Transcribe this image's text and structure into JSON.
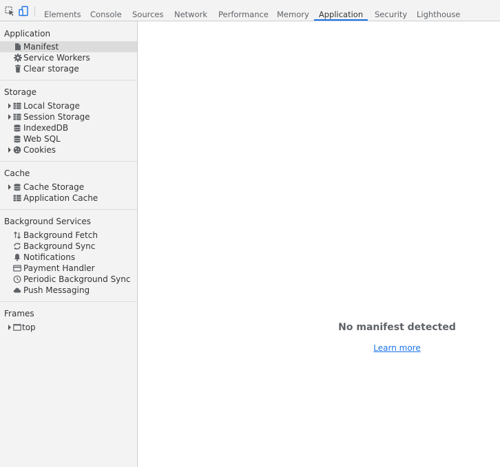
{
  "tabs": [
    "Elements",
    "Console",
    "Sources",
    "Network",
    "Performance",
    "Memory",
    "Application",
    "Security",
    "Lighthouse"
  ],
  "active_tab": "Application",
  "sidebar": {
    "application": {
      "title": "Application",
      "items": [
        {
          "label": "Manifest",
          "icon": "document-icon",
          "selected": true
        },
        {
          "label": "Service Workers",
          "icon": "gear-icon"
        },
        {
          "label": "Clear storage",
          "icon": "trash-icon"
        }
      ]
    },
    "storage": {
      "title": "Storage",
      "items": [
        {
          "label": "Local Storage",
          "icon": "table-icon",
          "expandable": true
        },
        {
          "label": "Session Storage",
          "icon": "table-icon",
          "expandable": true
        },
        {
          "label": "IndexedDB",
          "icon": "database-icon"
        },
        {
          "label": "Web SQL",
          "icon": "database-icon"
        },
        {
          "label": "Cookies",
          "icon": "cookie-icon",
          "expandable": true
        }
      ]
    },
    "cache": {
      "title": "Cache",
      "items": [
        {
          "label": "Cache Storage",
          "icon": "database-icon",
          "expandable": true
        },
        {
          "label": "Application Cache",
          "icon": "table-icon"
        }
      ]
    },
    "background": {
      "title": "Background Services",
      "items": [
        {
          "label": "Background Fetch",
          "icon": "up-down-arrows-icon"
        },
        {
          "label": "Background Sync",
          "icon": "sync-icon"
        },
        {
          "label": "Notifications",
          "icon": "bell-icon"
        },
        {
          "label": "Payment Handler",
          "icon": "card-icon"
        },
        {
          "label": "Periodic Background Sync",
          "icon": "clock-icon"
        },
        {
          "label": "Push Messaging",
          "icon": "cloud-icon"
        }
      ]
    },
    "frames": {
      "title": "Frames",
      "items": [
        {
          "label": "top",
          "icon": "frame-icon",
          "expandable": true
        }
      ]
    }
  },
  "main": {
    "title": "No manifest detected",
    "link": "Learn more"
  }
}
